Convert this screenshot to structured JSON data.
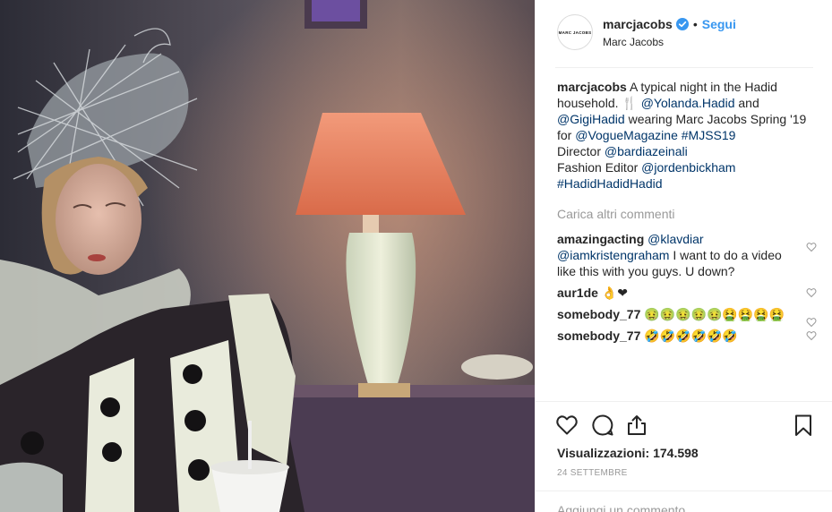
{
  "post": {
    "account_logo_text": "MARC JACOBS",
    "username": "marcjacobs",
    "dot": "•",
    "follow_label": "Segui",
    "full_name": "Marc Jacobs",
    "caption": {
      "username": "marcjacobs",
      "text_1": "A typical night in the Hadid household. 🍴 ",
      "mention_1": "@Yolanda.Hadid",
      "text_2": " and ",
      "mention_2": "@GigiHadid",
      "text_3": " wearing Marc Jacobs Spring '19 for ",
      "mention_3": "@VogueMagazine",
      "text_4": " ",
      "hashtag_1": "#MJSS19",
      "line_director": "Director ",
      "mention_4": "@bardiazeinali",
      "line_editor": "Fashion Editor ",
      "mention_5": "@jordenbickham",
      "hashtag_2": "#HadidHadidHadid"
    },
    "load_more_label": "Carica altri commenti",
    "comments": [
      {
        "username": "amazingacting",
        "mention_a": "@klavdiar",
        "mention_b": "@iamkristengraham",
        "text": " I want to do a video like this with you guys. U down?"
      },
      {
        "username": "aur1de",
        "text": "👌❤"
      },
      {
        "username": "somebody_77",
        "text": "🤢🤢🤢🤢🤢🤮🤮🤮🤮"
      },
      {
        "username": "somebody_77",
        "text": "🤣🤣🤣🤣🤣🤣"
      }
    ],
    "views_label": "Visualizzazioni: 174.598",
    "date": "24 SETTEMBRE",
    "add_comment_placeholder": "Aggiungi un commento..."
  },
  "icons": [
    "verified-badge-icon",
    "heart-icon",
    "comment-icon",
    "share-icon",
    "bookmark-icon",
    "like-comment-icon"
  ],
  "colors": {
    "link": "#003569",
    "follow": "#3897f0",
    "muted": "#999999",
    "text": "#262626"
  }
}
